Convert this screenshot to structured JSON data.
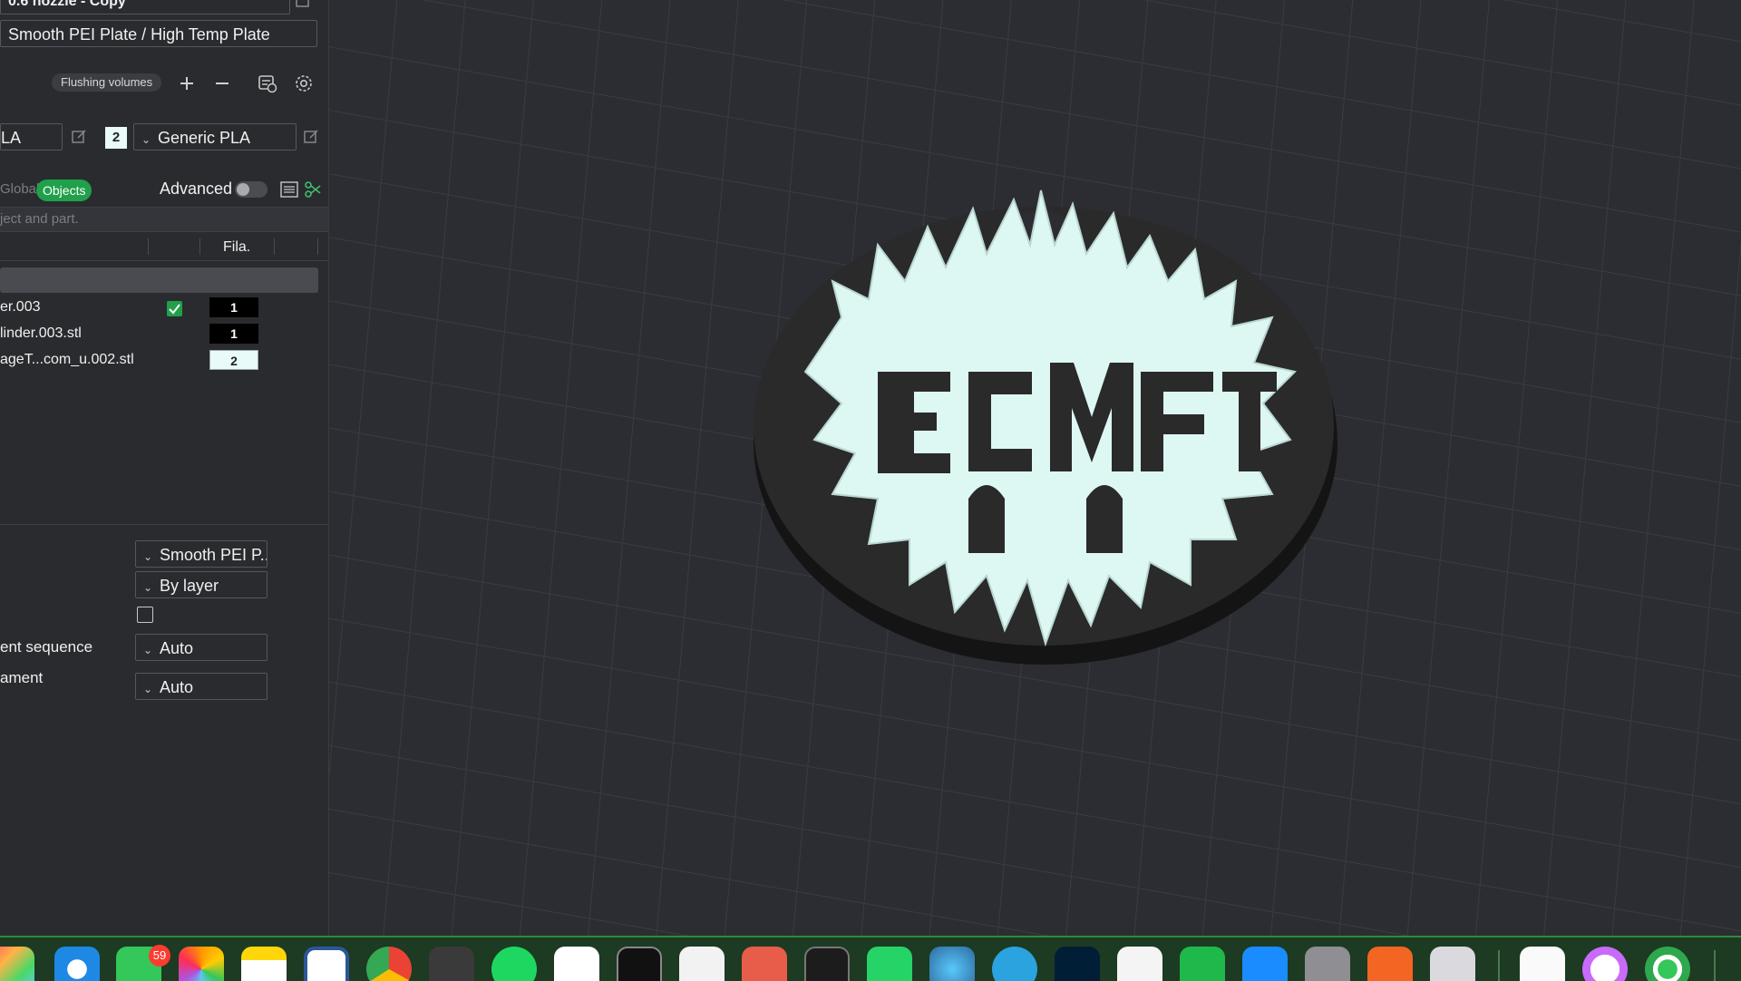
{
  "left_panel": {
    "nozzle_preset": "0.6 nozzle - Copy",
    "plate_type": "Smooth PEI Plate / High Temp Plate",
    "flushing_volumes_label": "Flushing volumes",
    "filaments": [
      {
        "label": "LA"
      },
      {
        "index": "2",
        "label": "Generic PLA"
      }
    ],
    "tabs": {
      "global": "Global",
      "objects": "Objects"
    },
    "advanced_label": "Advanced",
    "search_placeholder": "ject and part.",
    "column_fila": "Fila.",
    "objects": [
      {
        "name": "er.003",
        "filament": "1",
        "checked": true
      },
      {
        "name": "linder.003.stl",
        "filament": "1"
      },
      {
        "name": "ageT...com_u.002.stl",
        "filament": "2"
      }
    ],
    "plate_settings": {
      "bed_type": "Smooth PEI P...",
      "print_sequence_value": "By layer",
      "first_layer_sequence_label": "ent sequence",
      "first_layer_sequence_value": "Auto",
      "other_layers_label": "ament",
      "other_layers_value": "Auto"
    }
  },
  "dock": {
    "messages_badge": "59",
    "icons": [
      "launchpad-icon",
      "safari-icon",
      "messages-icon",
      "photos-icon",
      "notes-icon",
      "word-icon",
      "chrome-icon",
      "blender-icon",
      "spotify-icon",
      "home-icon",
      "terminal-icon",
      "cube-app-icon",
      "gear-app-icon",
      "activity-monitor-icon",
      "whatsapp-icon",
      "settings-gear-icon",
      "telegram-icon",
      "photoshop-icon",
      "maps-icon",
      "numbers-icon",
      "app-store-icon",
      "system-settings-icon",
      "fusion-icon",
      "iphone-mirroring-icon",
      "textedit-icon",
      "timer-icon",
      "find-my-icon"
    ]
  }
}
